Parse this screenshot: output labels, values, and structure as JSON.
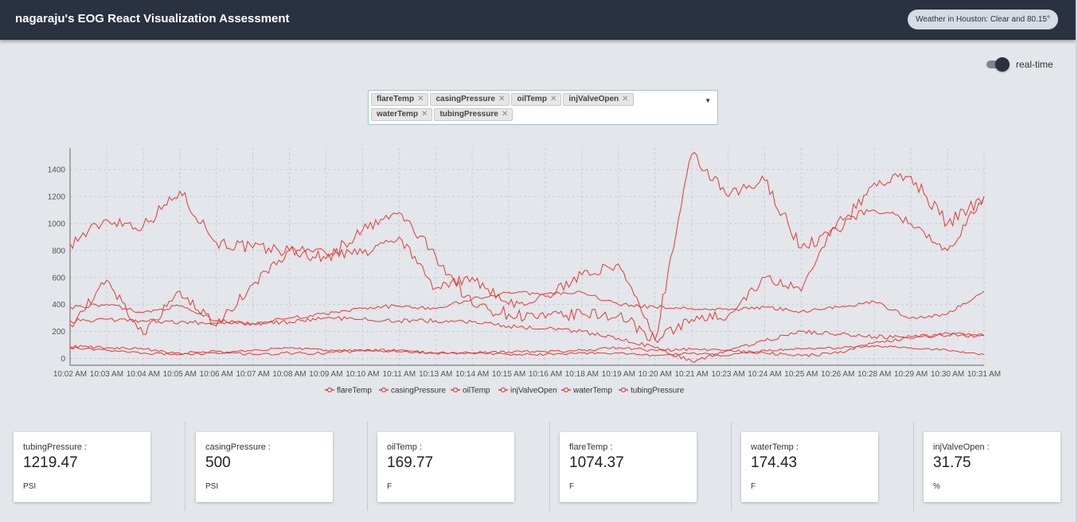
{
  "header": {
    "title": "nagaraju's EOG React Visualization Assessment",
    "weather": "Weather in Houston: Clear and 80.15°"
  },
  "toggle": {
    "label": "real-time",
    "on": true
  },
  "metric_select": {
    "selected": [
      "flareTemp",
      "casingPressure",
      "oilTemp",
      "injValveOpen",
      "waterTemp",
      "tubingPressure"
    ],
    "remove_glyph": "✕",
    "dropdown_icon": "caret-down-icon"
  },
  "chart_data": {
    "type": "line",
    "x": [
      "10:02 AM",
      "10:03 AM",
      "10:04 AM",
      "10:05 AM",
      "10:06 AM",
      "10:07 AM",
      "10:08 AM",
      "10:09 AM",
      "10:10 AM",
      "10:11 AM",
      "10:13 AM",
      "10:14 AM",
      "10:15 AM",
      "10:16 AM",
      "10:18 AM",
      "10:19 AM",
      "10:20 AM",
      "10:21 AM",
      "10:23 AM",
      "10:24 AM",
      "10:25 AM",
      "10:26 AM",
      "10:28 AM",
      "10:29 AM",
      "10:30 AM",
      "10:31 AM"
    ],
    "y_ticks": [
      0,
      200,
      400,
      600,
      800,
      1000,
      1200,
      1400
    ],
    "ylim": [
      -50,
      1560
    ],
    "grid": true,
    "legend_position": "bottom",
    "line_color": "#e53935",
    "series": [
      {
        "name": "flareTemp",
        "values": [
          850,
          1030,
          980,
          1240,
          860,
          820,
          800,
          740,
          950,
          1080,
          760,
          400,
          330,
          300,
          330,
          320,
          140,
          1510,
          1200,
          1320,
          820,
          950,
          1300,
          1350,
          1000,
          1200
        ]
      },
      {
        "name": "casingPressure",
        "values": [
          380,
          400,
          340,
          390,
          280,
          260,
          300,
          330,
          370,
          390,
          370,
          440,
          490,
          480,
          490,
          400,
          380,
          370,
          360,
          380,
          350,
          380,
          420,
          300,
          330,
          500
        ]
      },
      {
        "name": "oilTemp",
        "values": [
          90,
          80,
          70,
          40,
          50,
          30,
          40,
          40,
          60,
          60,
          40,
          40,
          50,
          50,
          60,
          80,
          60,
          70,
          60,
          40,
          20,
          40,
          120,
          150,
          190,
          170
        ]
      },
      {
        "name": "injValveOpen",
        "values": [
          80,
          60,
          40,
          30,
          40,
          60,
          80,
          60,
          60,
          50,
          40,
          40,
          30,
          30,
          40,
          40,
          20,
          40,
          20,
          60,
          70,
          80,
          90,
          80,
          60,
          30
        ]
      },
      {
        "name": "waterTemp",
        "values": [
          280,
          290,
          280,
          270,
          260,
          260,
          270,
          300,
          290,
          280,
          280,
          270,
          240,
          220,
          200,
          150,
          80,
          -20,
          60,
          130,
          200,
          180,
          160,
          160,
          170,
          170
        ]
      },
      {
        "name": "tubingPressure",
        "values": [
          250,
          580,
          180,
          500,
          240,
          550,
          800,
          780,
          780,
          900,
          520,
          600,
          400,
          460,
          620,
          700,
          140,
          290,
          320,
          600,
          500,
          1020,
          1100,
          1000,
          800,
          1200
        ]
      }
    ]
  },
  "cards": [
    {
      "label": "tubingPressure :",
      "value": "1219.47",
      "unit": "PSI"
    },
    {
      "label": "casingPressure :",
      "value": "500",
      "unit": "PSI"
    },
    {
      "label": "oilTemp :",
      "value": "169.77",
      "unit": "F"
    },
    {
      "label": "flareTemp :",
      "value": "1074.37",
      "unit": "F"
    },
    {
      "label": "waterTemp :",
      "value": "174.43",
      "unit": "F"
    },
    {
      "label": "injValveOpen :",
      "value": "31.75",
      "unit": "%"
    }
  ]
}
